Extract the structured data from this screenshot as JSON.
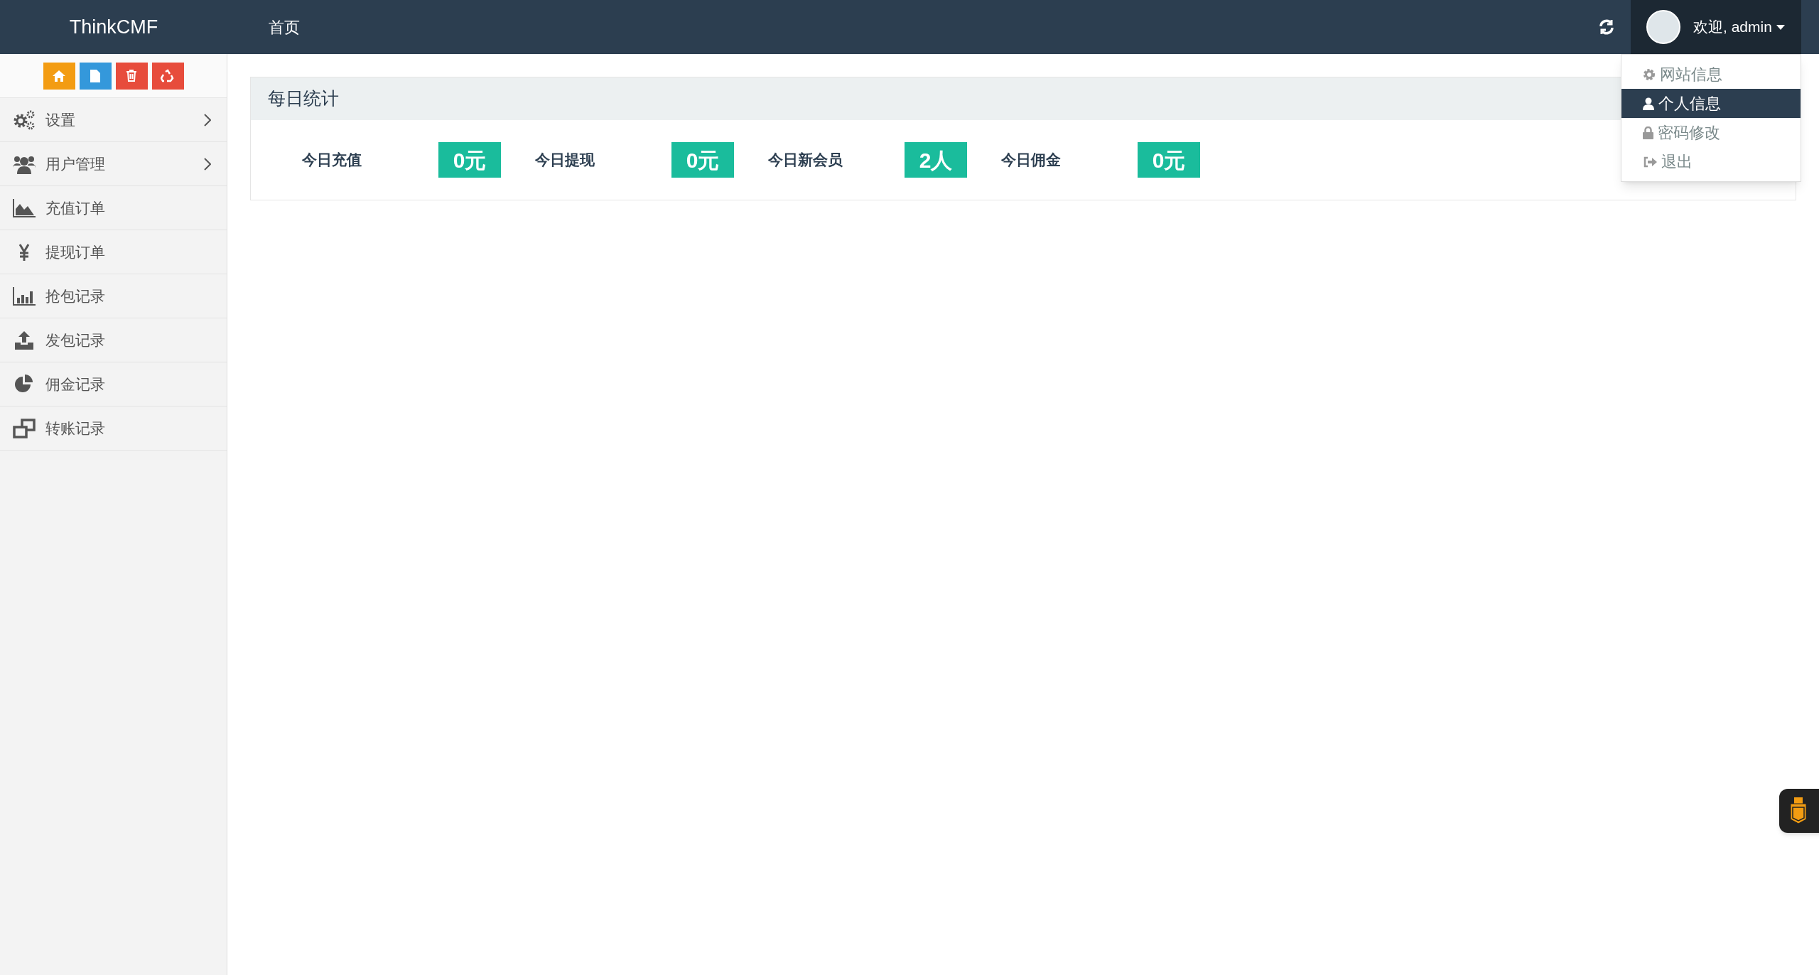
{
  "navbar": {
    "brand": "ThinkCMF",
    "nav_links": [
      {
        "label": "首页"
      }
    ],
    "user": {
      "greeting": "欢迎, admin"
    }
  },
  "user_menu": [
    {
      "label": "网站信息",
      "selected": false
    },
    {
      "label": "个人信息",
      "selected": true
    },
    {
      "label": "密码修改",
      "selected": false
    },
    {
      "label": "退出",
      "selected": false
    }
  ],
  "sidebar": {
    "items": [
      {
        "label": "设置",
        "has_submenu": true
      },
      {
        "label": "用户管理",
        "has_submenu": true
      },
      {
        "label": "充值订单",
        "has_submenu": false
      },
      {
        "label": "提现订单",
        "has_submenu": false
      },
      {
        "label": "抢包记录",
        "has_submenu": false
      },
      {
        "label": "发包记录",
        "has_submenu": false
      },
      {
        "label": "佣金记录",
        "has_submenu": false
      },
      {
        "label": "转账记录",
        "has_submenu": false
      }
    ]
  },
  "panel": {
    "title": "每日统计",
    "stats": [
      {
        "label": "今日充值",
        "value": "0元"
      },
      {
        "label": "今日提现",
        "value": "0元"
      },
      {
        "label": "今日新会员",
        "value": "2人"
      },
      {
        "label": "今日佣金",
        "value": "0元"
      }
    ]
  }
}
